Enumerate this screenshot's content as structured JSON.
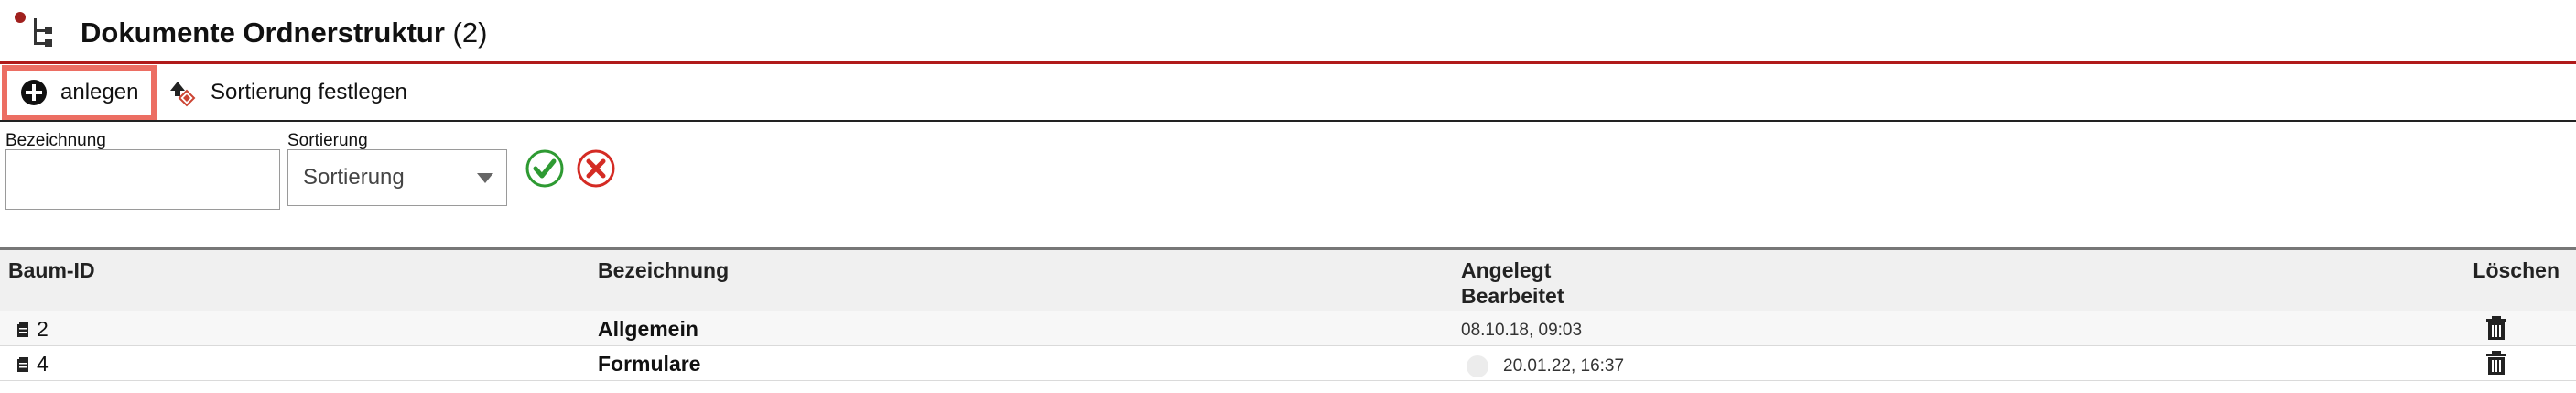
{
  "header": {
    "title": "Dokumente Ordnerstruktur",
    "count": "(2)",
    "accent_color": "#b01a1a"
  },
  "toolbar": {
    "create_label": "anlegen",
    "create_icon": "plus-circle-icon",
    "sort_label": "Sortierung festlegen",
    "sort_icon": "sort-order-icon"
  },
  "filter": {
    "bezeichnung_label": "Bezeichnung",
    "bezeichnung_value": "",
    "sortierung_label": "Sortierung",
    "sortierung_value": "Sortierung",
    "apply_icon": "checkmark-icon",
    "reset_icon": "cancel-x-icon"
  },
  "table": {
    "headers": {
      "id": "Baum-ID",
      "bezeichnung": "Bezeichnung",
      "angelegt": "Angelegt",
      "bearbeitet": "Bearbeitet",
      "loeschen": "Löschen"
    },
    "rows": [
      {
        "id": "2",
        "bezeichnung": "Allgemein",
        "date": "08.10.18, 09:03"
      },
      {
        "id": "4",
        "bezeichnung": "Formulare",
        "date": "20.01.22, 16:37"
      }
    ]
  }
}
